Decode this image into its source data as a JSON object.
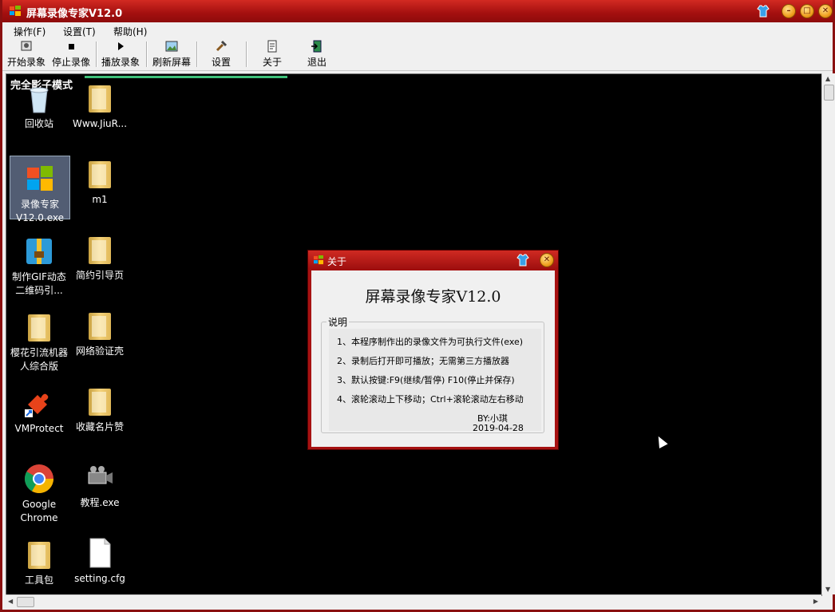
{
  "window": {
    "title": "屏幕录像专家V12.0"
  },
  "menu": {
    "items": [
      "操作(F)",
      "设置(T)",
      "帮助(H)"
    ]
  },
  "toolbar": {
    "start": "开始录象",
    "stop": "停止录像",
    "play": "播放录象",
    "refresh": "刷新屏幕",
    "settings": "设置",
    "about": "关于",
    "exit": "退出"
  },
  "screen": {
    "mode_label": "完全影子模式",
    "icons": {
      "recycle": "回收站",
      "www": "Www.JiuR...",
      "app_line1": "录像专家",
      "app_line2": "V12.0.exe",
      "m1": "m1",
      "gif_line1": "制作GIF动态",
      "gif_line2": "二维码引...",
      "jianyue": "简约引导页",
      "sakura_line1": "樱花引流机器",
      "sakura_line2": "人综合版",
      "net": "网络验证壳",
      "vmp": "VMProtect",
      "card": "收藏名片赞",
      "chrome_line1": "Google",
      "chrome_line2": "Chrome",
      "tutorial": "教程.exe",
      "tools": "工具包",
      "cfg": "setting.cfg"
    }
  },
  "dialog": {
    "title": "关于",
    "app_title": "屏幕录像专家V12.0",
    "group_label": "说明",
    "lines": [
      "1、本程序制作出的录像文件为可执行文件(exe)",
      "2、录制后打开即可播放；无需第三方播放器",
      "3、默认按键:F9(继续/暂停) F10(停止并保存)",
      "4、滚轮滚动上下移动；Ctrl+滚轮滚动左右移动"
    ],
    "author": "BY:小琪",
    "date": "2019-04-28"
  },
  "colors": {
    "title_red": "#a30f0f",
    "screen_bg": "#000000",
    "accent_green": "#3fc07a"
  }
}
